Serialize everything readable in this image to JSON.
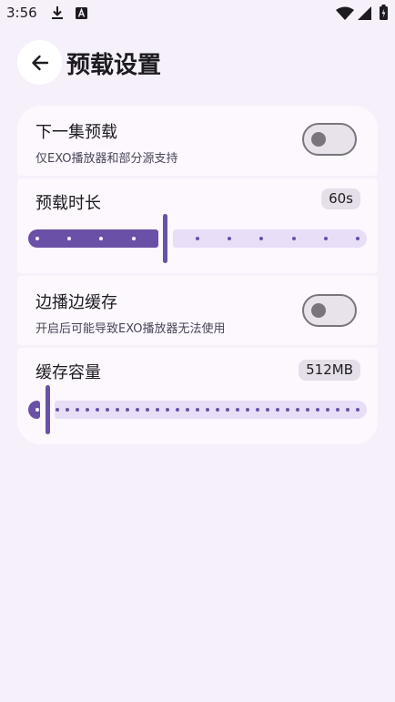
{
  "status_bar": {
    "time": "3:56",
    "icons": [
      "download-icon",
      "a-notification-icon",
      "wifi-icon",
      "signal-icon",
      "battery-icon"
    ]
  },
  "header": {
    "back_icon": "arrow-left-icon",
    "title": "预载设置"
  },
  "settings": {
    "next_episode_preload": {
      "title": "下一集预载",
      "subtitle": "仅EXO播放器和部分源支持",
      "enabled": false
    },
    "preload_duration": {
      "title": "预载时长",
      "value_label": "60s",
      "slider": {
        "steps": 10,
        "index": 4
      }
    },
    "play_while_cache": {
      "title": "边播边缓存",
      "subtitle": "开启后可能导致EXO播放器无法使用",
      "enabled": false
    },
    "cache_capacity": {
      "title": "缓存容量",
      "value_label": "512MB",
      "slider": {
        "steps": 32,
        "index": 1
      }
    }
  },
  "colors": {
    "background": "#f6f0fa",
    "card": "#fcf8fe",
    "accent": "#6a50a6",
    "track_inactive": "#e8def8",
    "switch_outline": "#79747e"
  }
}
